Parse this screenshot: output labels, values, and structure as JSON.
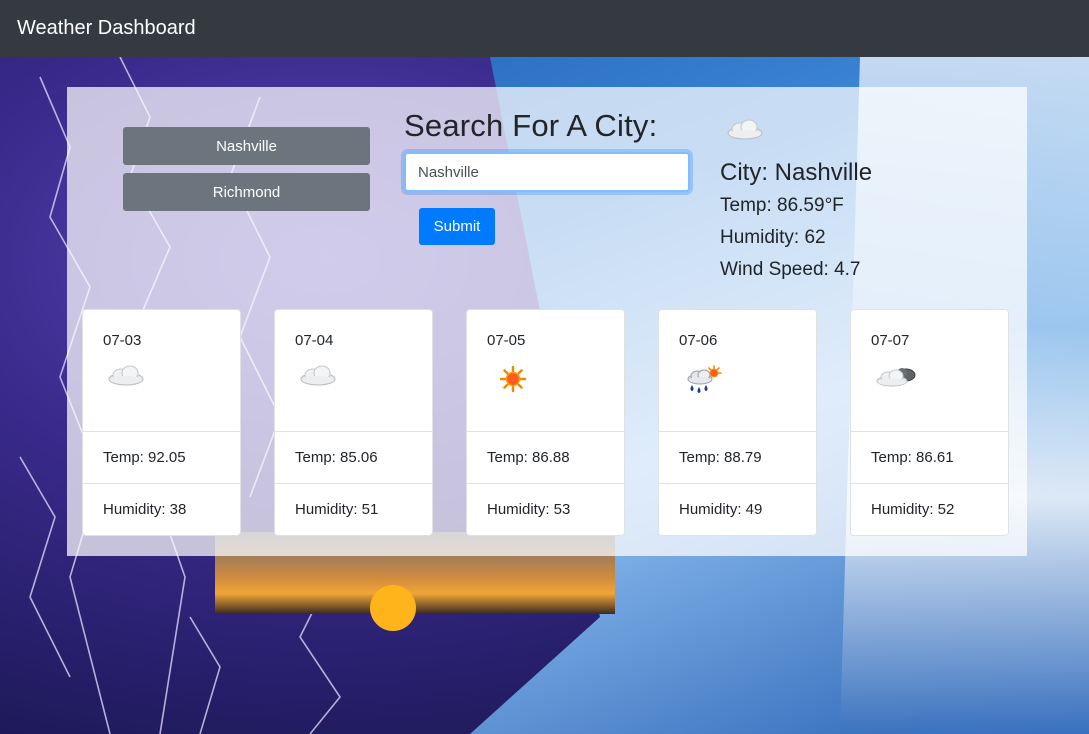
{
  "navbar": {
    "title": "Weather Dashboard"
  },
  "history": [
    {
      "label": "Nashville"
    },
    {
      "label": "Richmond"
    }
  ],
  "search": {
    "title": "Search For A City:",
    "value": "Nashville",
    "submit_label": "Submit"
  },
  "current": {
    "icon": "cloud-icon",
    "city": "City: Nashville",
    "temp": "Temp: 86.59°F",
    "humidity": "Humidity: 62",
    "wind": "Wind Speed: 4.7"
  },
  "forecast": [
    {
      "date": "07-03",
      "icon": "cloud-icon",
      "temp": "Temp: 92.05",
      "humidity": "Humidity: 38"
    },
    {
      "date": "07-04",
      "icon": "cloud-icon",
      "temp": "Temp: 85.06",
      "humidity": "Humidity: 51"
    },
    {
      "date": "07-05",
      "icon": "sun-icon",
      "temp": "Temp: 86.88",
      "humidity": "Humidity: 53"
    },
    {
      "date": "07-06",
      "icon": "rain-sun-icon",
      "temp": "Temp: 88.79",
      "humidity": "Humidity: 49"
    },
    {
      "date": "07-07",
      "icon": "partly-cloudy-icon",
      "temp": "Temp: 86.61",
      "humidity": "Humidity: 52"
    }
  ],
  "colors": {
    "navbar": "#343a40",
    "secondary_button": "#6c757d",
    "primary_button": "#007bff"
  }
}
